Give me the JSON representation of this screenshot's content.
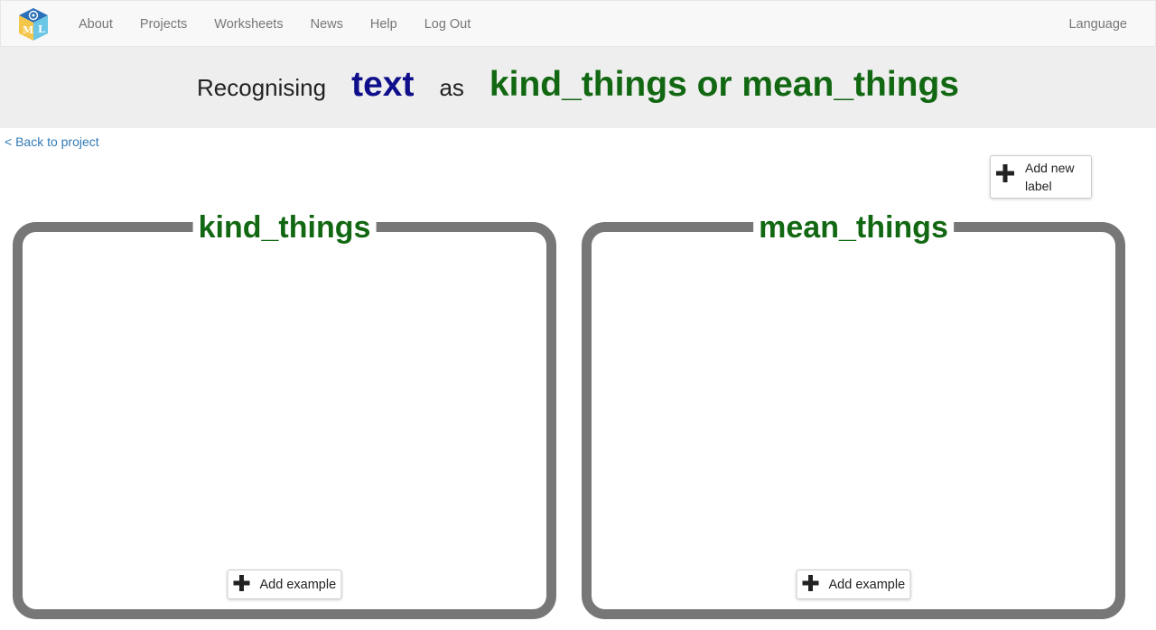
{
  "nav": {
    "logo_icon": "ml-blocks-logo-icon",
    "links": [
      "About",
      "Projects",
      "Worksheets",
      "News",
      "Help",
      "Log Out"
    ],
    "language": "Language"
  },
  "title": {
    "prefix": "Recognising",
    "type": "text",
    "middle": "as",
    "labels": "kind_things or mean_things"
  },
  "back_link": "< Back to project",
  "add_label_button": {
    "label": "Add new label",
    "icon": "plus-icon"
  },
  "buckets": [
    {
      "name": "kind_things",
      "add_example": "Add example"
    },
    {
      "name": "mean_things",
      "add_example": "Add example"
    }
  ],
  "colors": {
    "label_green": "#126812",
    "type_blue": "#0f0f8c",
    "bucket_border": "#777777",
    "link_blue": "#337ab7"
  }
}
